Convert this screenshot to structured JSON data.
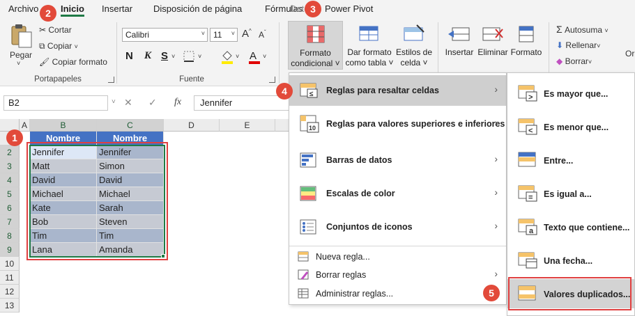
{
  "tabs": [
    "Archivo",
    "Inicio",
    "Insertar",
    "Disposición de página",
    "Fórmulas",
    "Datos",
    "Power Pivot"
  ],
  "ribbon": {
    "paste": "Pegar",
    "cut": "Cortar",
    "copy": "Copiar",
    "format_painter": "Copiar formato",
    "group_clipboard": "Portapapeles",
    "font_name": "Calibri",
    "font_size": "11",
    "bold": "N",
    "italic": "K",
    "underline": "S",
    "font_color_letter": "A",
    "group_font": "Fuente",
    "cond_format_line1": "Formato",
    "cond_format_line2": "condicional",
    "table_format_line1": "Dar formato",
    "table_format_line2": "como tabla",
    "cell_styles_line1": "Estilos de",
    "cell_styles_line2": "celda",
    "insert": "Insertar",
    "delete": "Eliminar",
    "format": "Formato",
    "autosum": "Autosuma",
    "fill": "Rellenar",
    "clear": "Borrar",
    "cut_off_label": "Or"
  },
  "formula_bar": {
    "name_box": "B2",
    "fx": "fx",
    "value": "Jennifer"
  },
  "grid": {
    "columns": [
      "A",
      "B",
      "C",
      "D",
      "E"
    ],
    "rows": [
      "1",
      "2",
      "3",
      "4",
      "5",
      "6",
      "7",
      "8",
      "9",
      "10",
      "11",
      "12",
      "13"
    ],
    "header_b": "Nombre",
    "header_c": "Nombre",
    "col_b": [
      "Jennifer",
      "Matt",
      "David",
      "Michael",
      "Kate",
      "Bob",
      "Tim",
      "Lana"
    ],
    "col_c": [
      "Jennifer",
      "Simon",
      "David",
      "Michael",
      "Sarah",
      "Steven",
      "Tim",
      "Amanda"
    ]
  },
  "menu": {
    "highlight_rules": "Reglas para resaltar celdas",
    "top_bottom": "Reglas para valores superiores e inferiores",
    "data_bars": "Barras de datos",
    "color_scales": "Escalas de color",
    "icon_sets": "Conjuntos de iconos",
    "new_rule": "Nueva regla...",
    "clear_rules": "Borrar reglas",
    "manage_rules": "Administrar reglas..."
  },
  "submenu": {
    "greater": "Es mayor que...",
    "less": "Es menor que...",
    "between": "Entre...",
    "equal": "Es igual a...",
    "text_contains": "Texto que contiene...",
    "date": "Una fecha...",
    "duplicates": "Valores duplicados..."
  },
  "badges": [
    "1",
    "2",
    "3",
    "4",
    "5"
  ],
  "colors": {
    "accent_green": "#1f7a45",
    "table_header": "#4472c4",
    "annotation_red": "#e24a3a"
  }
}
